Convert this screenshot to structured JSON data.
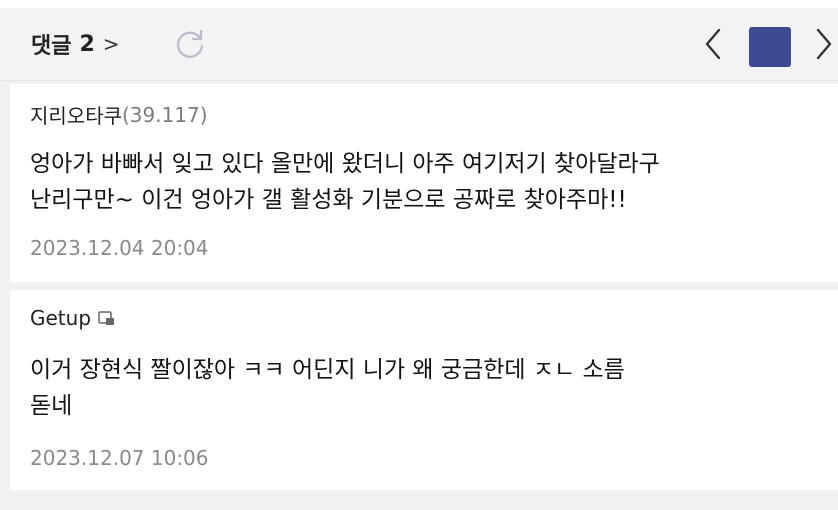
{
  "header": {
    "comment_label": "댓글",
    "comment_count": "2",
    "chevron": ">",
    "refresh_icon": "refresh-icon",
    "prev_icon": "chevron-left-icon",
    "next_icon": "chevron-right-icon",
    "accent_color": "#3d4a8f"
  },
  "comments": [
    {
      "author": "지리오타쿠",
      "score": "(39.117)",
      "body": "엉아가 바빠서 잊고 있다 올만에 왔더니 아주 여기저기 찾아달라구\n난리구만~ 이건 엉아가 갤 활성화 기분으로 공짜로 찾아주마!!",
      "date": "2023.12.04 20:04"
    },
    {
      "author": "Getup",
      "badge_icon": "member-badge-icon",
      "body": "이거 장현식 짤이잖아 ㅋㅋ 어딘지 니가 왜 궁금한데 ㅈㄴ 소름\n돋네",
      "date": "2023.12.07 10:06"
    }
  ]
}
